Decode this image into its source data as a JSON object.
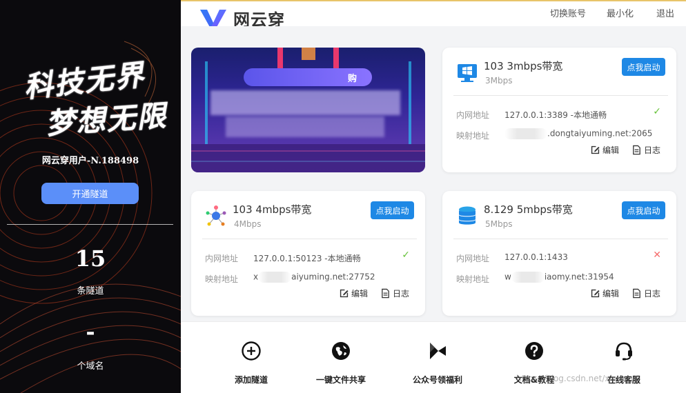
{
  "app": {
    "name": "网云穿"
  },
  "header": {
    "switch_account": "切换账号",
    "minimize": "最小化",
    "logout": "退出"
  },
  "sidebar": {
    "slogan_line1": "科技无界",
    "slogan_line2": "梦想无限",
    "username": "网云穿用户-N.188498",
    "open_tunnel_label": "开通隧道",
    "tunnel_count": "15",
    "tunnel_count_label": "条隧道",
    "domain_count": "-",
    "domain_count_label": "个域名"
  },
  "banner": {
    "pill_text": "购"
  },
  "tunnels": [
    {
      "title": "103   3mbps带宽",
      "speed": "3Mbps",
      "icon": "windows-monitor-icon",
      "start_label": "点我启动",
      "local_label": "内网地址",
      "local_value": "127.0.0.1:3389 -本地通畅",
      "mapped_label": "映射地址",
      "mapped_value": ".dongtaiyuming.net:2065",
      "status": "ok",
      "edit_label": "编辑",
      "log_label": "日志"
    },
    {
      "title": "103   4mbps带宽",
      "speed": "4Mbps",
      "icon": "network-nodes-icon",
      "start_label": "点我启动",
      "local_label": "内网地址",
      "local_value": "127.0.0.1:50123 -本地通畅",
      "mapped_label": "映射地址",
      "mapped_prefix": "x",
      "mapped_value": "aiyuming.net:27752",
      "status": "ok",
      "edit_label": "编辑",
      "log_label": "日志"
    },
    {
      "title": "8.129   5mbps带宽",
      "speed": "5Mbps",
      "icon": "database-icon",
      "start_label": "点我启动",
      "local_label": "内网地址",
      "local_value": "127.0.0.1:1433",
      "mapped_label": "映射地址",
      "mapped_prefix": "w",
      "mapped_value": "iaomy.net:31954",
      "status": "error",
      "edit_label": "编辑",
      "log_label": "日志"
    }
  ],
  "status_symbols": {
    "ok": "✓",
    "error": "✕"
  },
  "toolbar": [
    {
      "label": "添加隧道",
      "icon": "add-circle-icon"
    },
    {
      "label": "一键文件共享",
      "icon": "globe-share-icon"
    },
    {
      "label": "公众号领福利",
      "icon": "wechat-official-icon"
    },
    {
      "label": "文档&教程",
      "icon": "help-icon"
    },
    {
      "label": "在线客服",
      "icon": "headset-icon"
    }
  ],
  "watermark": "https://blog.csdn.net/xiaomy",
  "colors": {
    "accent": "#1e88e5",
    "sidebar_button": "#5b8ff9",
    "ok": "#67c23a",
    "error": "#f56c6c",
    "sidebar_bg": "#0b0a0d"
  }
}
